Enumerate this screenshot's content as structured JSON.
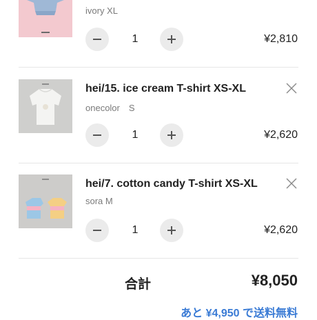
{
  "cart": {
    "items": [
      {
        "title": "",
        "variant": "ivory XL",
        "quantity": "1",
        "price": "¥2,810",
        "thumbnail": "pink-background-denim-shirt-photo",
        "removable": false
      },
      {
        "title": "hei/15. ice cream T-shirt XS-XL",
        "variant": "onecolor　S",
        "quantity": "1",
        "price": "¥2,620",
        "thumbnail": "white-tshirt-photo",
        "removable": true
      },
      {
        "title": "hei/7. cotton candy T-shirt XS-XL",
        "variant": "sora M",
        "quantity": "1",
        "price": "¥2,620",
        "thumbnail": "pastel-tshirts-photo",
        "removable": true
      }
    ]
  },
  "summary": {
    "total_label": "合計",
    "total_value": "¥8,050",
    "free_shipping_note": "あと ¥4,950 で送料無料"
  },
  "icons": {
    "remove": "close-icon",
    "minus": "minus-icon",
    "plus": "plus-icon"
  },
  "colors": {
    "accent": "#3a7bd5",
    "button_bg": "#ebebeb",
    "divider": "#e6e6e6",
    "muted_text": "#7a7a7a",
    "text": "#222222"
  }
}
